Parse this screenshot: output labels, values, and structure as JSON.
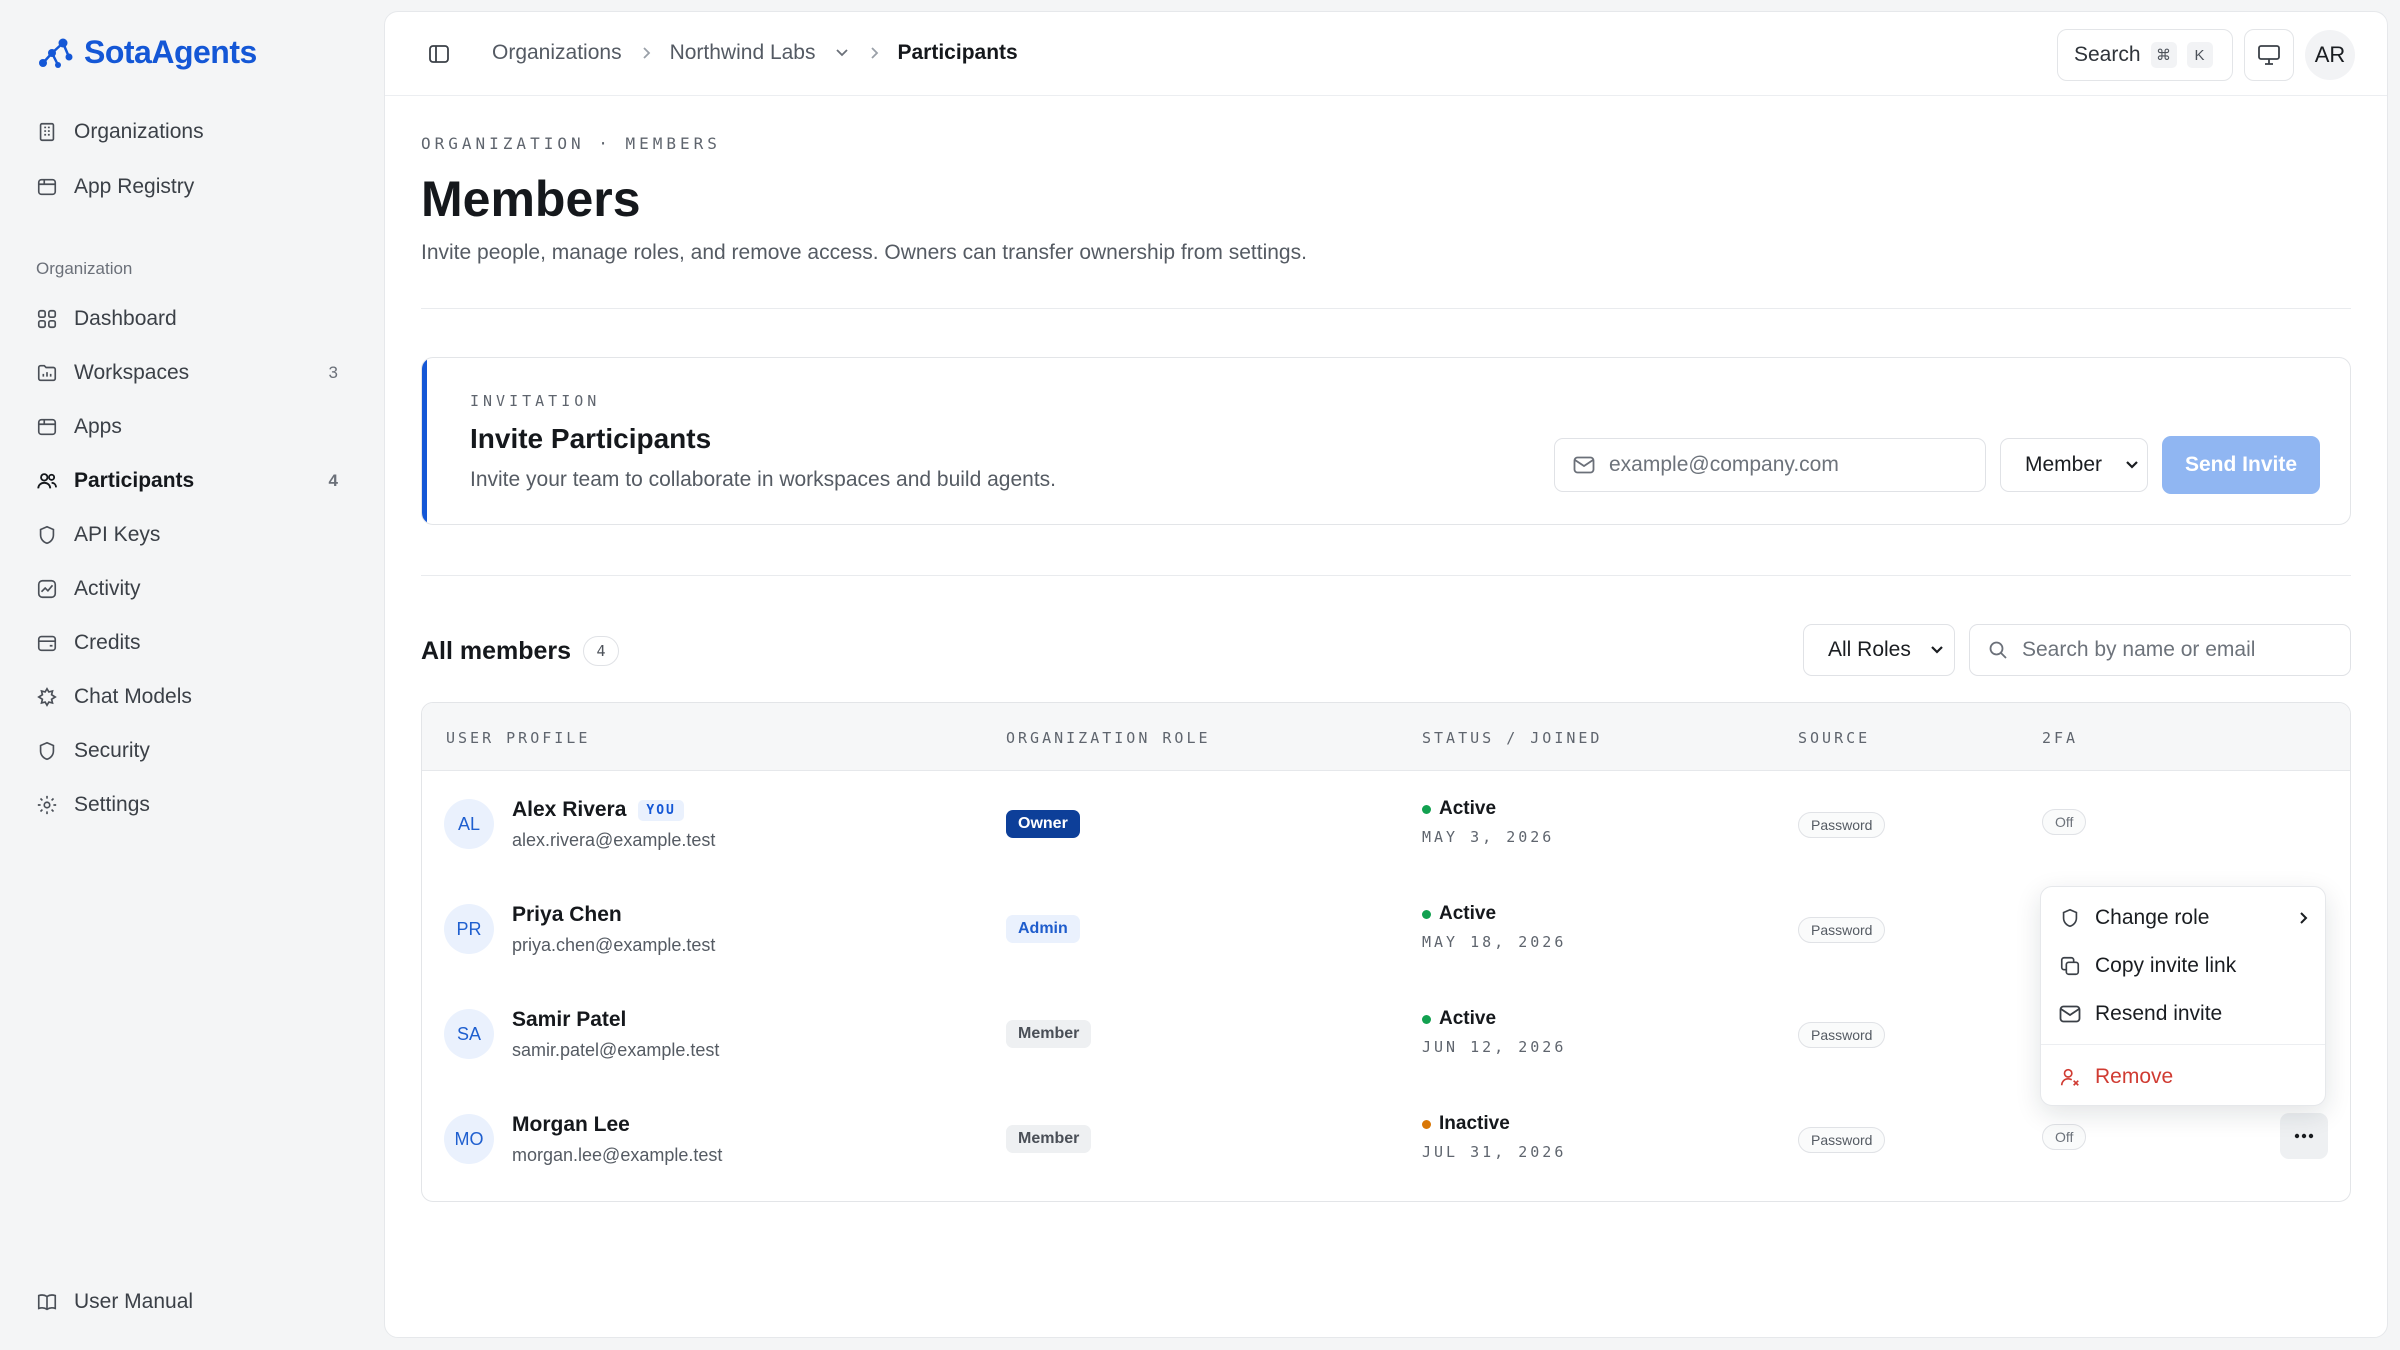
{
  "brand": {
    "name": "SotaAgents",
    "accent": "#1457d6"
  },
  "sidebar": {
    "top_items": [
      {
        "label": "Organizations",
        "icon": "building-icon"
      },
      {
        "label": "App Registry",
        "icon": "package-icon"
      }
    ],
    "section_label": "Organization",
    "items": [
      {
        "label": "Dashboard",
        "icon": "grid-icon",
        "badge": ""
      },
      {
        "label": "Workspaces",
        "icon": "folder-icon",
        "badge": "3"
      },
      {
        "label": "Apps",
        "icon": "package-icon",
        "badge": ""
      },
      {
        "label": "Participants",
        "icon": "users-icon",
        "badge": "4",
        "active": true
      },
      {
        "label": "API Keys",
        "icon": "shield-icon",
        "badge": ""
      },
      {
        "label": "Activity",
        "icon": "activity-icon",
        "badge": ""
      },
      {
        "label": "Credits",
        "icon": "wallet-icon",
        "badge": ""
      },
      {
        "label": "Chat Models",
        "icon": "sparkle-icon",
        "badge": ""
      },
      {
        "label": "Security",
        "icon": "shield-icon",
        "badge": ""
      },
      {
        "label": "Settings",
        "icon": "gear-icon",
        "badge": ""
      }
    ],
    "footer": {
      "label": "User Manual",
      "icon": "book-icon"
    }
  },
  "topbar": {
    "breadcrumbs": [
      "Organizations",
      "Northwind Labs",
      "Participants"
    ],
    "search_label": "Search",
    "search_kbd": [
      "⌘",
      "K"
    ],
    "user_initials": "AR"
  },
  "page": {
    "eyebrow": "ORGANIZATION · MEMBERS",
    "title": "Members",
    "description": "Invite people, manage roles, and remove access. Owners can transfer ownership from settings."
  },
  "invite": {
    "eyebrow": "INVITATION",
    "title": "Invite Participants",
    "description": "Invite your team to collaborate in workspaces and build agents.",
    "email_placeholder": "example@company.com",
    "role_value": "Member",
    "send_label": "Send Invite"
  },
  "members": {
    "title": "All members",
    "count": "4",
    "role_filter": "All Roles",
    "search_placeholder": "Search by name or email",
    "columns": [
      "USER PROFILE",
      "ORGANIZATION ROLE",
      "STATUS / JOINED",
      "SOURCE",
      "2FA"
    ],
    "rows": [
      {
        "initials": "AL",
        "name": "Alex Rivera",
        "you": "YOU",
        "email": "alex.rivera@example.test",
        "role": "Owner",
        "status": "Active",
        "status_color": "#12a150",
        "joined": "MAY 3, 2026",
        "source": "Password",
        "twofa": "Off"
      },
      {
        "initials": "PR",
        "name": "Priya Chen",
        "you": "",
        "email": "priya.chen@example.test",
        "role": "Admin",
        "status": "Active",
        "status_color": "#12a150",
        "joined": "MAY 18, 2026",
        "source": "Password",
        "twofa": ""
      },
      {
        "initials": "SA",
        "name": "Samir Patel",
        "you": "",
        "email": "samir.patel@example.test",
        "role": "Member",
        "status": "Active",
        "status_color": "#12a150",
        "joined": "JUN 12, 2026",
        "source": "Password",
        "twofa": ""
      },
      {
        "initials": "MO",
        "name": "Morgan Lee",
        "you": "",
        "email": "morgan.lee@example.test",
        "role": "Member",
        "status": "Inactive",
        "status_color": "#d97706",
        "joined": "JUL 31, 2026",
        "source": "Password",
        "twofa": "Off"
      }
    ]
  },
  "context_menu": {
    "items": [
      "Change role",
      "Copy invite link",
      "Resend invite"
    ],
    "danger_item": "Remove"
  }
}
